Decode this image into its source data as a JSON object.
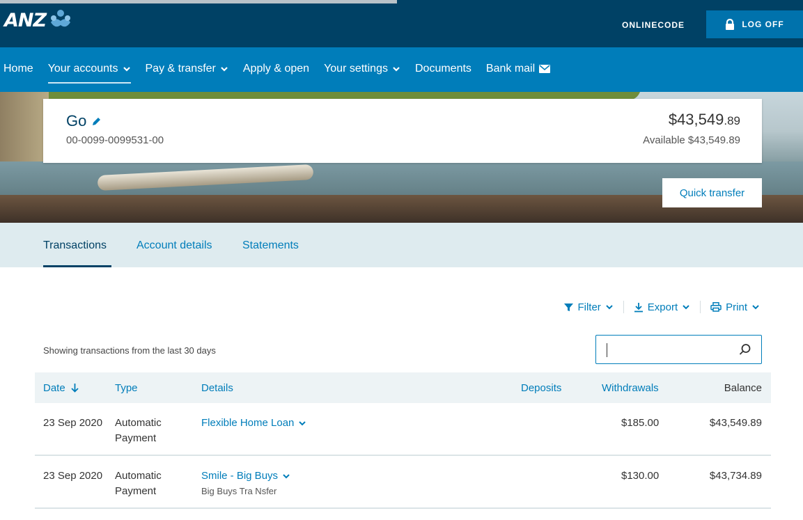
{
  "brand": {
    "logo_text": "ANZ"
  },
  "header": {
    "onlinecode_label": "ONLINECODE",
    "logoff_label": "LOG OFF"
  },
  "nav": {
    "items": [
      {
        "label": "Home"
      },
      {
        "label": "Your accounts"
      },
      {
        "label": "Pay & transfer"
      },
      {
        "label": "Apply & open"
      },
      {
        "label": "Your settings"
      },
      {
        "label": "Documents"
      },
      {
        "label": "Bank mail"
      }
    ]
  },
  "account": {
    "name": "Go",
    "number": "00-0099-0099531-00",
    "balance_dollars": "$43,549",
    "balance_cents": ".89",
    "available": "Available $43,549.89",
    "quick_transfer_label": "Quick transfer"
  },
  "tabs": [
    {
      "label": "Transactions",
      "active": true
    },
    {
      "label": "Account details",
      "active": false
    },
    {
      "label": "Statements",
      "active": false
    }
  ],
  "toolbar": {
    "filter_label": "Filter",
    "export_label": "Export",
    "print_label": "Print"
  },
  "transactions": {
    "showing_text": "Showing transactions from the last 30 days",
    "search_value": "",
    "columns": {
      "date": "Date",
      "type": "Type",
      "details": "Details",
      "deposits": "Deposits",
      "withdrawals": "Withdrawals",
      "balance": "Balance"
    },
    "rows": [
      {
        "date": "23 Sep 2020",
        "type_line1": "Automatic",
        "type_line2": "Payment",
        "details": "Flexible Home Loan",
        "subdetails": "",
        "deposits": "",
        "withdrawals": "$185.00",
        "balance": "$43,549.89"
      },
      {
        "date": "23 Sep 2020",
        "type_line1": "Automatic",
        "type_line2": "Payment",
        "details": "Smile - Big Buys",
        "subdetails": "Big Buys Tra Nsfer",
        "deposits": "",
        "withdrawals": "$130.00",
        "balance": "$43,734.89"
      }
    ]
  },
  "colors": {
    "header_bg": "#004165",
    "nav_bg": "#007dba",
    "link": "#007dba",
    "tabs_bg": "#deebef"
  }
}
